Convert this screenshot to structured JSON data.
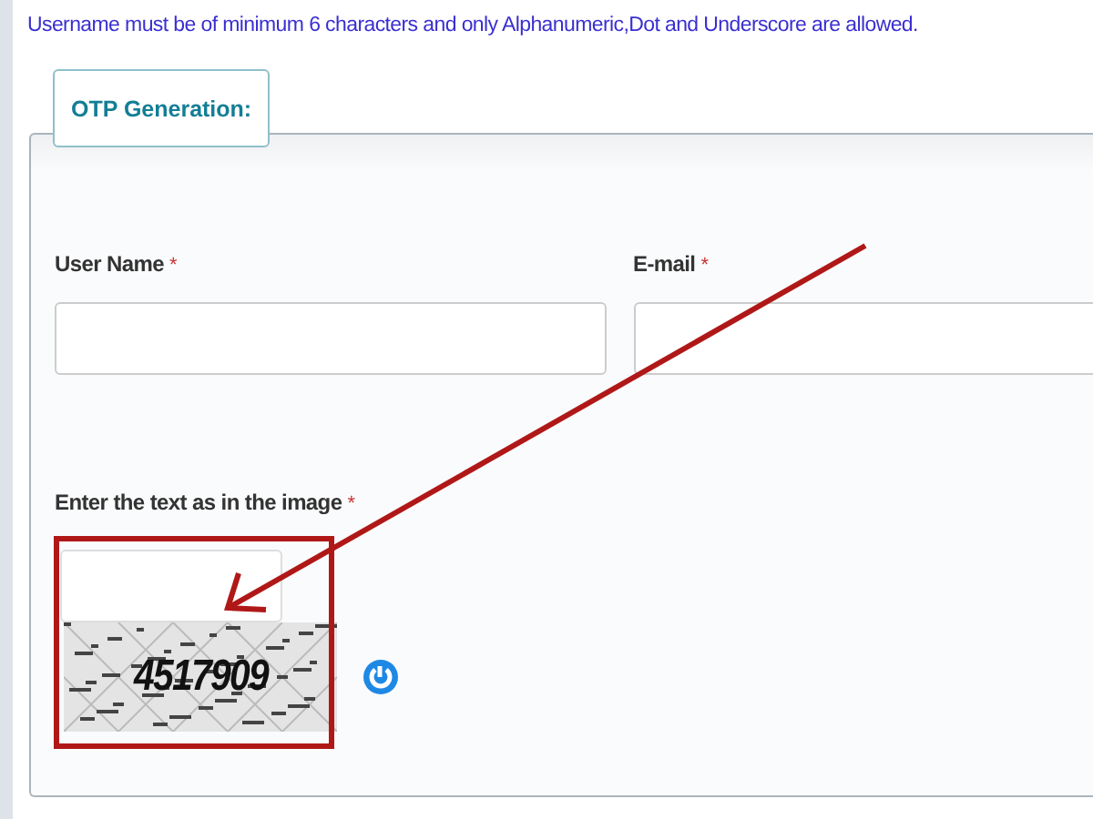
{
  "hint": "Username must be of minimum 6 characters and only Alphanumeric,Dot and Underscore are allowed.",
  "legend": "OTP Generation:",
  "fields": [
    {
      "label": "User Name",
      "required_mark": "*"
    },
    {
      "label": "E-mail",
      "required_mark": "*"
    }
  ],
  "captcha": {
    "label": "Enter the text as in the image",
    "required_mark": "*",
    "code": "4517909"
  }
}
